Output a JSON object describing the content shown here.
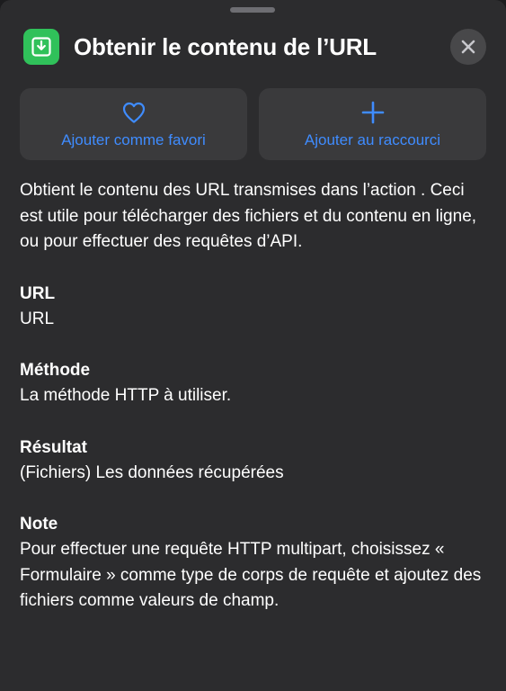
{
  "header": {
    "title": "Obtenir le contenu de l’URL",
    "app_icon": "download-tray-icon",
    "app_icon_color": "#30c15a",
    "close_icon": "close-icon"
  },
  "actions": [
    {
      "label": "Ajouter comme favori",
      "icon": "heart-icon"
    },
    {
      "label": "Ajouter au raccourci",
      "icon": "plus-icon"
    }
  ],
  "accent_color": "#3f8cff",
  "description": "Obtient le contenu des URL transmises dans l’action . Ceci est utile pour télécharger des fichiers et du contenu en ligne, ou pour effectuer des requêtes d’API.",
  "sections": [
    {
      "title": "URL",
      "body": "URL"
    },
    {
      "title": "Méthode",
      "body": "La méthode HTTP à utiliser."
    },
    {
      "title": "Résultat",
      "body": "(Fichiers) Les données récupérées"
    },
    {
      "title": "Note",
      "body": "Pour effectuer une requête HTTP multipart, choisissez « Formulaire » comme type de corps de requête et ajoutez des fichiers comme valeurs de champ."
    }
  ]
}
